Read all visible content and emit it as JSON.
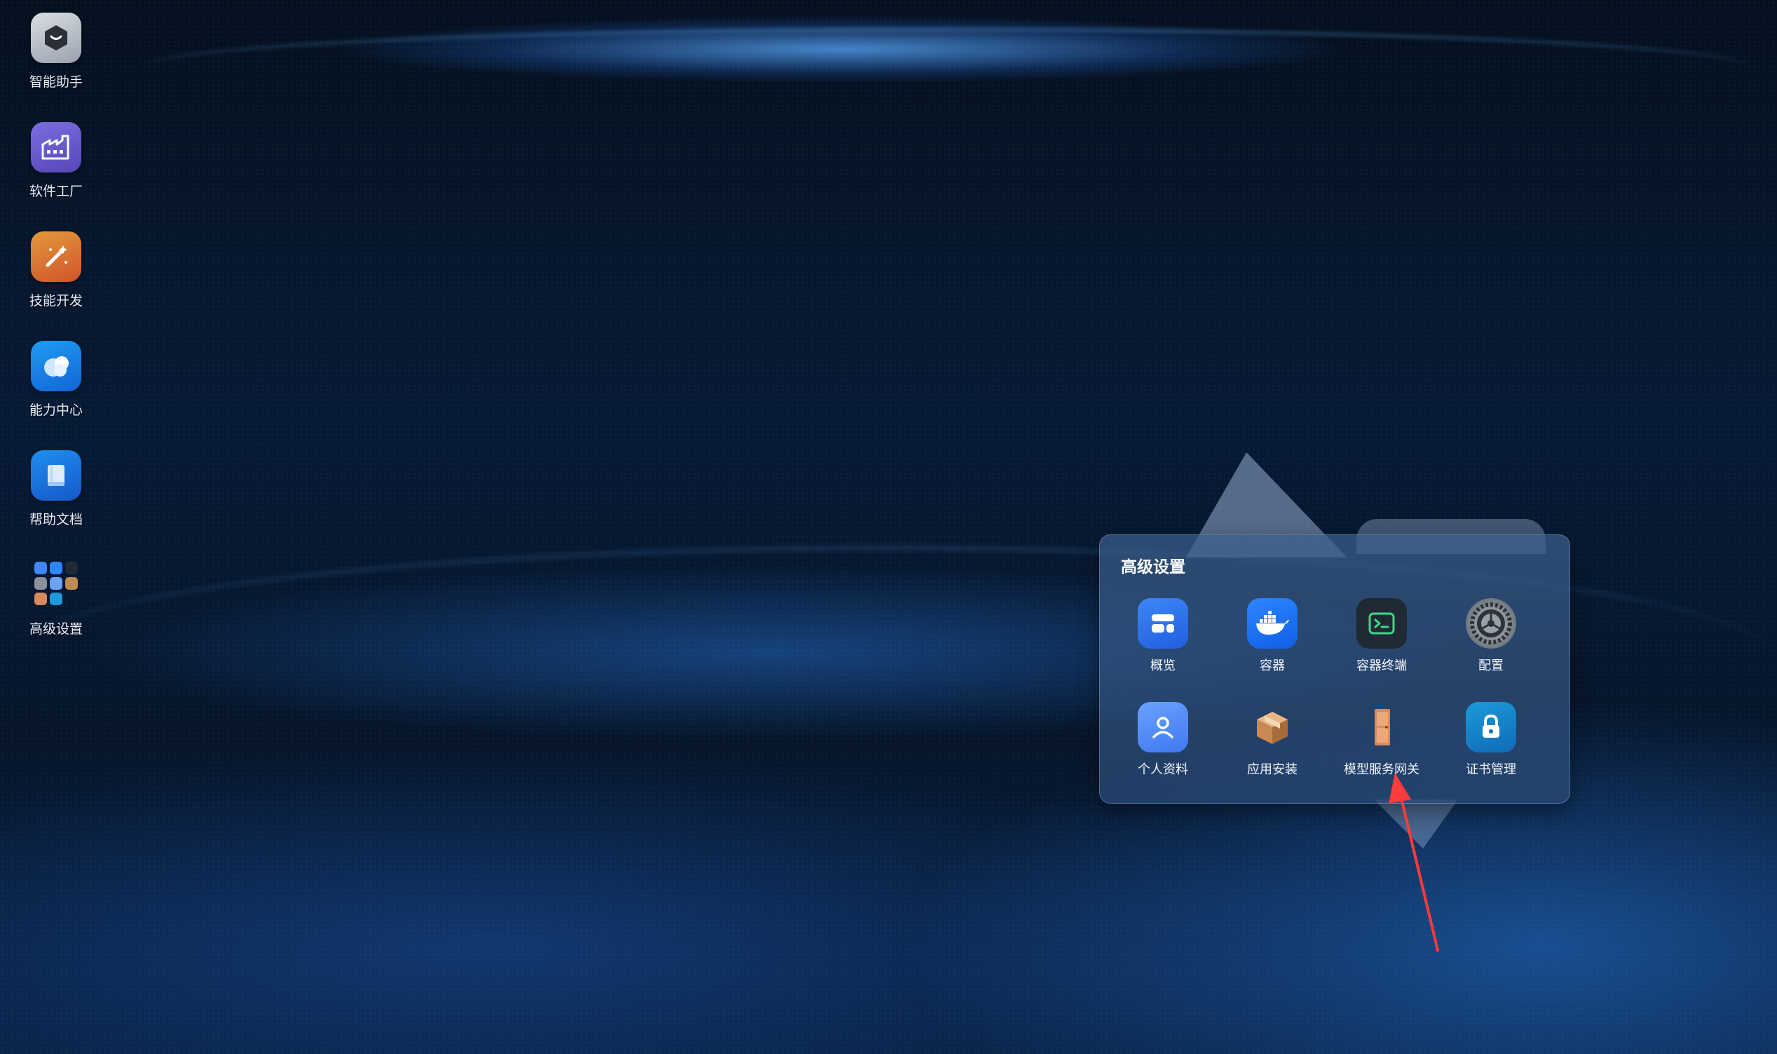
{
  "desktop": {
    "items": [
      {
        "label": "智能助手",
        "icon": "assistant-icon"
      },
      {
        "label": "软件工厂",
        "icon": "factory-icon"
      },
      {
        "label": "技能开发",
        "icon": "magic-wand-icon"
      },
      {
        "label": "能力中心",
        "icon": "cloud-icon"
      },
      {
        "label": "帮助文档",
        "icon": "book-icon"
      },
      {
        "label": "高级设置",
        "icon": "folder-grid-icon"
      }
    ]
  },
  "folder": {
    "title": "高级设置",
    "apps": [
      {
        "label": "概览",
        "icon": "overview-icon"
      },
      {
        "label": "容器",
        "icon": "docker-icon"
      },
      {
        "label": "容器终端",
        "icon": "terminal-icon"
      },
      {
        "label": "配置",
        "icon": "gear-icon"
      },
      {
        "label": "个人资料",
        "icon": "user-icon"
      },
      {
        "label": "应用安装",
        "icon": "package-icon"
      },
      {
        "label": "模型服务网关",
        "icon": "door-icon"
      },
      {
        "label": "证书管理",
        "icon": "lock-icon"
      }
    ]
  },
  "colors": {
    "background": "#06152a",
    "panel": "#3c5f8c",
    "arrow": "#ff3b3b"
  }
}
